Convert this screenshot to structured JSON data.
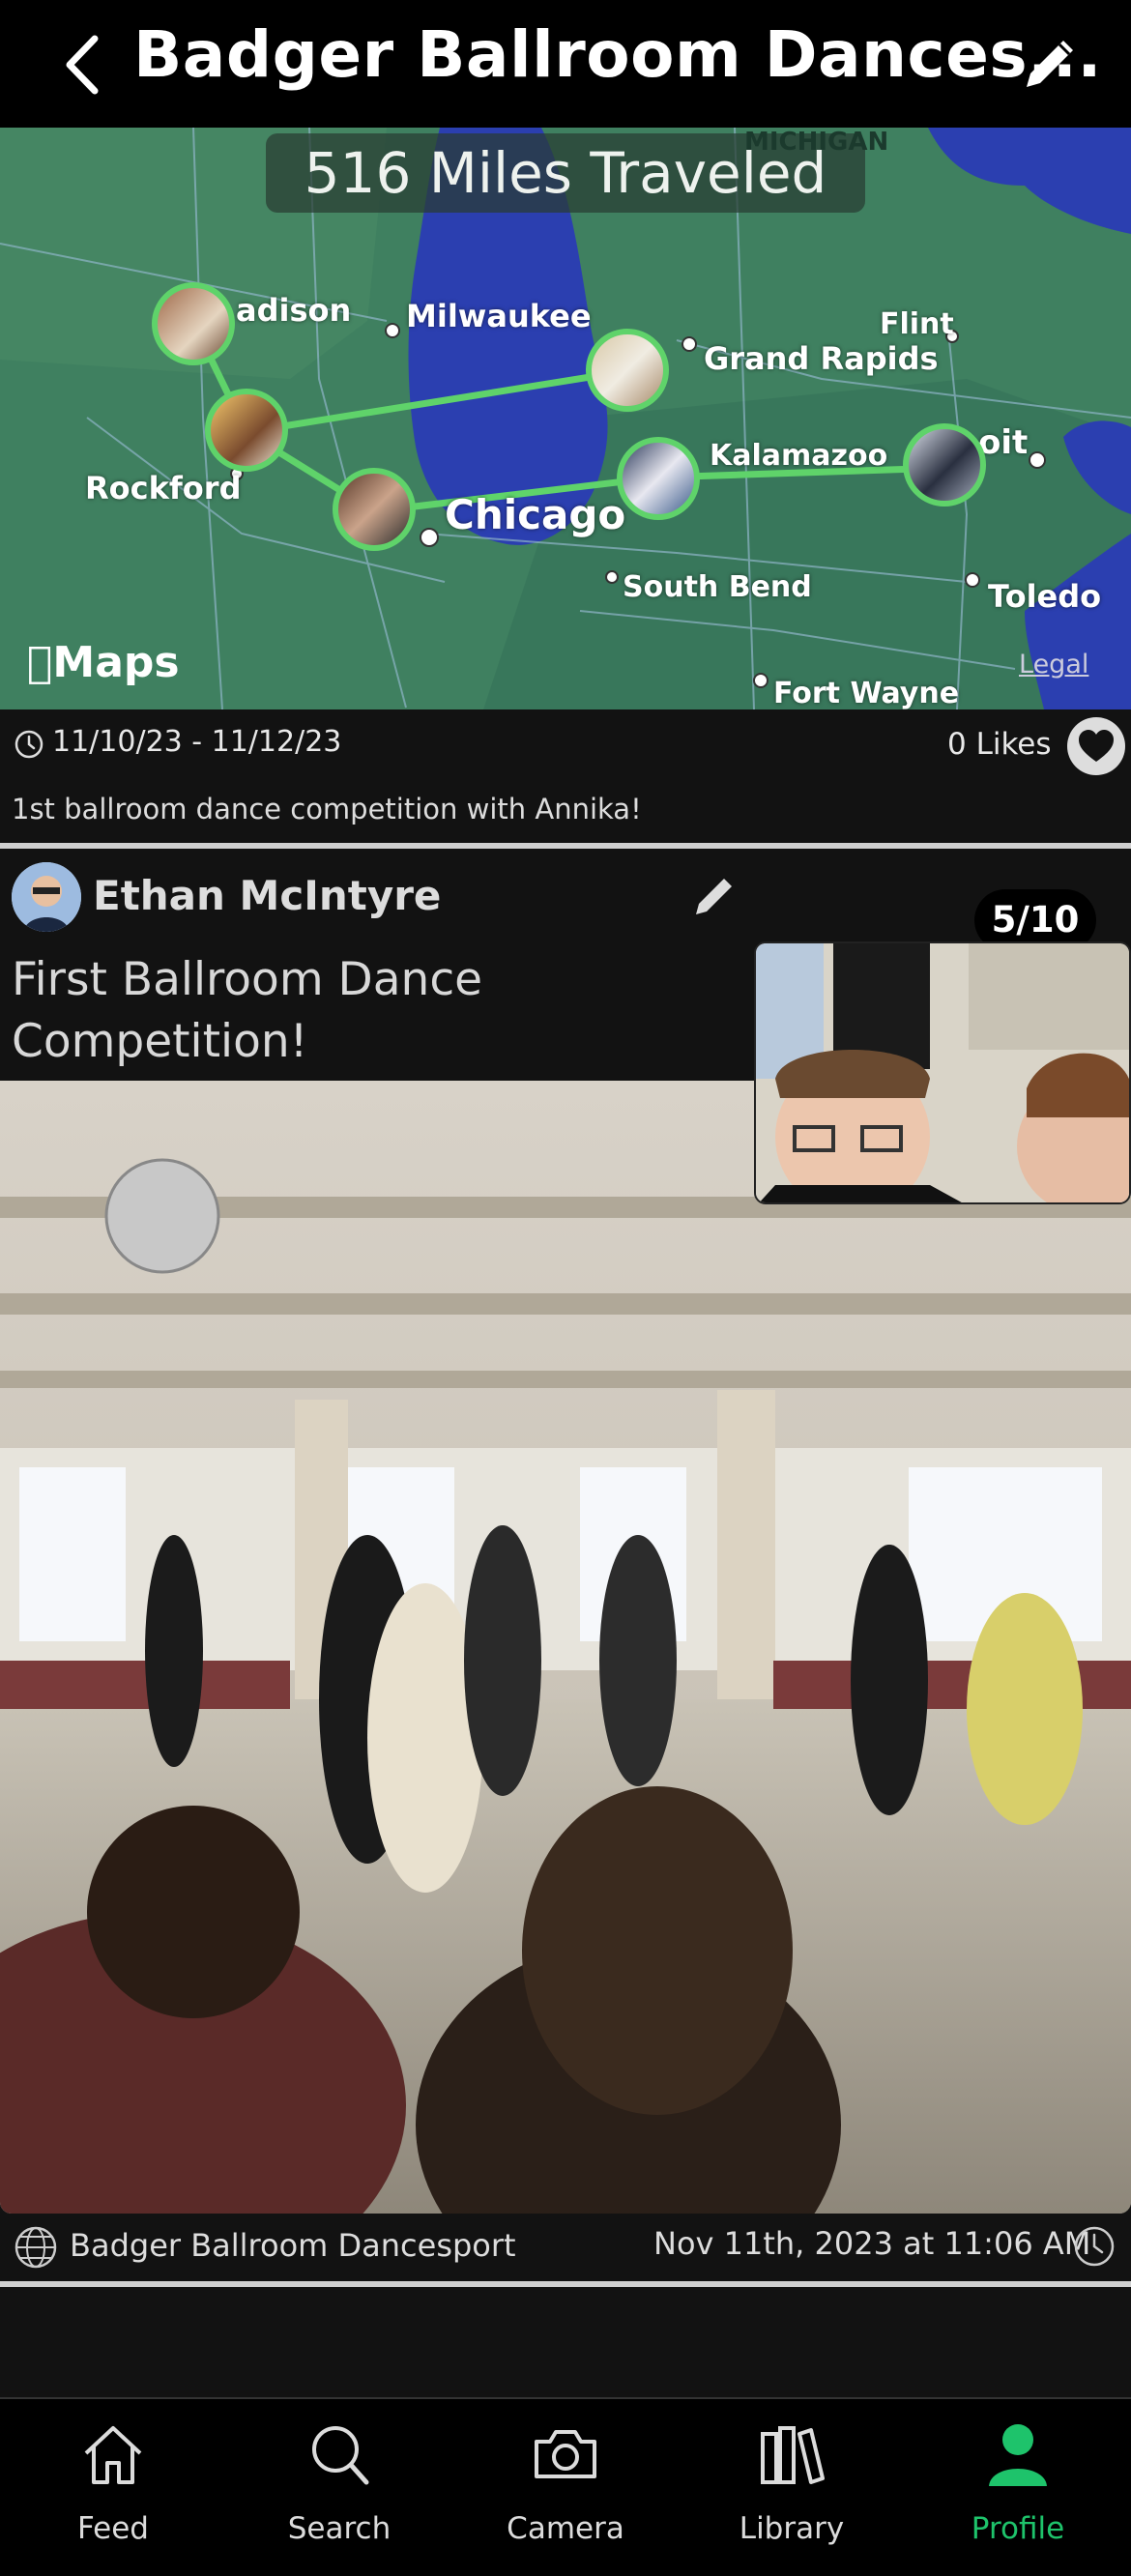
{
  "header": {
    "title": "Badger Ballroom Dances...",
    "back_icon": "chevron-left-icon",
    "edit_icon": "pencil-icon"
  },
  "map": {
    "miles_label": "516 Miles Traveled",
    "region_label": "MICHIGAN",
    "cities": {
      "madison": "adison",
      "milwaukee": "Milwaukee",
      "rockford": "Rockford",
      "chicago": "Chicago",
      "grand_rapids": "Grand Rapids",
      "flint": "Flint",
      "kalamazoo": "Kalamazoo",
      "detroit": "oit",
      "south_bend": "South Bend",
      "toledo": "Toledo",
      "fort_wayne": "Fort Wayne"
    },
    "maps_logo": "Maps",
    "legal": "Legal",
    "route_color": "#5fd36a"
  },
  "trip": {
    "dates": "11/10/23 - 11/12/23",
    "likes": "0 Likes",
    "description": "1st ballroom dance competition with Annika!"
  },
  "post": {
    "author": "Ethan McIntyre",
    "counter": "5/10",
    "title": "First Ballroom Dance Competition!",
    "location": "Badger Ballroom Dancesport",
    "timestamp": "Nov 11th, 2023 at 11:06 AM"
  },
  "tabs": [
    {
      "label": "Feed",
      "icon": "home-icon"
    },
    {
      "label": "Search",
      "icon": "search-icon"
    },
    {
      "label": "Camera",
      "icon": "camera-icon"
    },
    {
      "label": "Library",
      "icon": "library-icon"
    },
    {
      "label": "Profile",
      "icon": "profile-icon",
      "active": true
    }
  ],
  "colors": {
    "accent": "#1ec36b",
    "background": "#121212"
  }
}
